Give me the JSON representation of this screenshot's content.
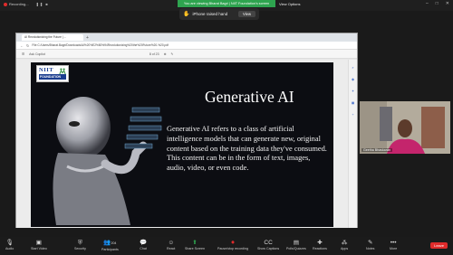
{
  "topbar": {
    "recording_label": "Recording...",
    "viewing_banner": "You are viewing Bharat Bagri | NIIT Foundation's screen",
    "view_options": "View Options"
  },
  "toast": {
    "message": "iPhone raised hand",
    "view_button": "View"
  },
  "browser": {
    "tab_title": "AI Revolutionizing the Future | ...",
    "url": "File  C:/Users/Bharat.Bagri/Downloads/AI%20%E2%80%94Revolutionizing%20the%20Future%20-%20.pdf",
    "ask_copilot": "Ask Copilot",
    "page_indicator": "8 of 23"
  },
  "slide": {
    "logo_line1": "NIIT",
    "logo_line2": "FOUNDATION",
    "title": "Generative AI",
    "body": "Generative AI refers to a class of artificial intelligence models that can generate new, original content based on the training data they've consumed. This content can be in the form of text, images, audio, video, or even code."
  },
  "participant": {
    "name": "Geetha Bhaskaran"
  },
  "toolbar": {
    "buttons": [
      {
        "label": "Audio",
        "icon": "microphone-icon"
      },
      {
        "label": "Start Video",
        "icon": "video-icon"
      },
      {
        "label": "Security",
        "icon": "shield-icon"
      },
      {
        "label": "Participants",
        "icon": "participants-icon",
        "count": "204"
      },
      {
        "label": "Chat",
        "icon": "chat-icon"
      },
      {
        "label": "React",
        "icon": "react-icon"
      },
      {
        "label": "Share Screen",
        "icon": "share-screen-icon"
      },
      {
        "label": "Pause/stop recording",
        "icon": "record-icon"
      },
      {
        "label": "Show Captions",
        "icon": "captions-icon"
      },
      {
        "label": "Polls/Quizzes",
        "icon": "polls-icon"
      },
      {
        "label": "Reactions",
        "icon": "reactions-icon"
      },
      {
        "label": "Apps",
        "icon": "apps-icon"
      },
      {
        "label": "Notes",
        "icon": "notes-icon"
      },
      {
        "label": "More",
        "icon": "more-icon"
      }
    ],
    "leave": "Leave"
  },
  "colors": {
    "accent_green": "#2ea44f",
    "leave_red": "#e02b2b",
    "slide_bg": "#0c0d12",
    "logo_blue": "#1b3d8f"
  }
}
